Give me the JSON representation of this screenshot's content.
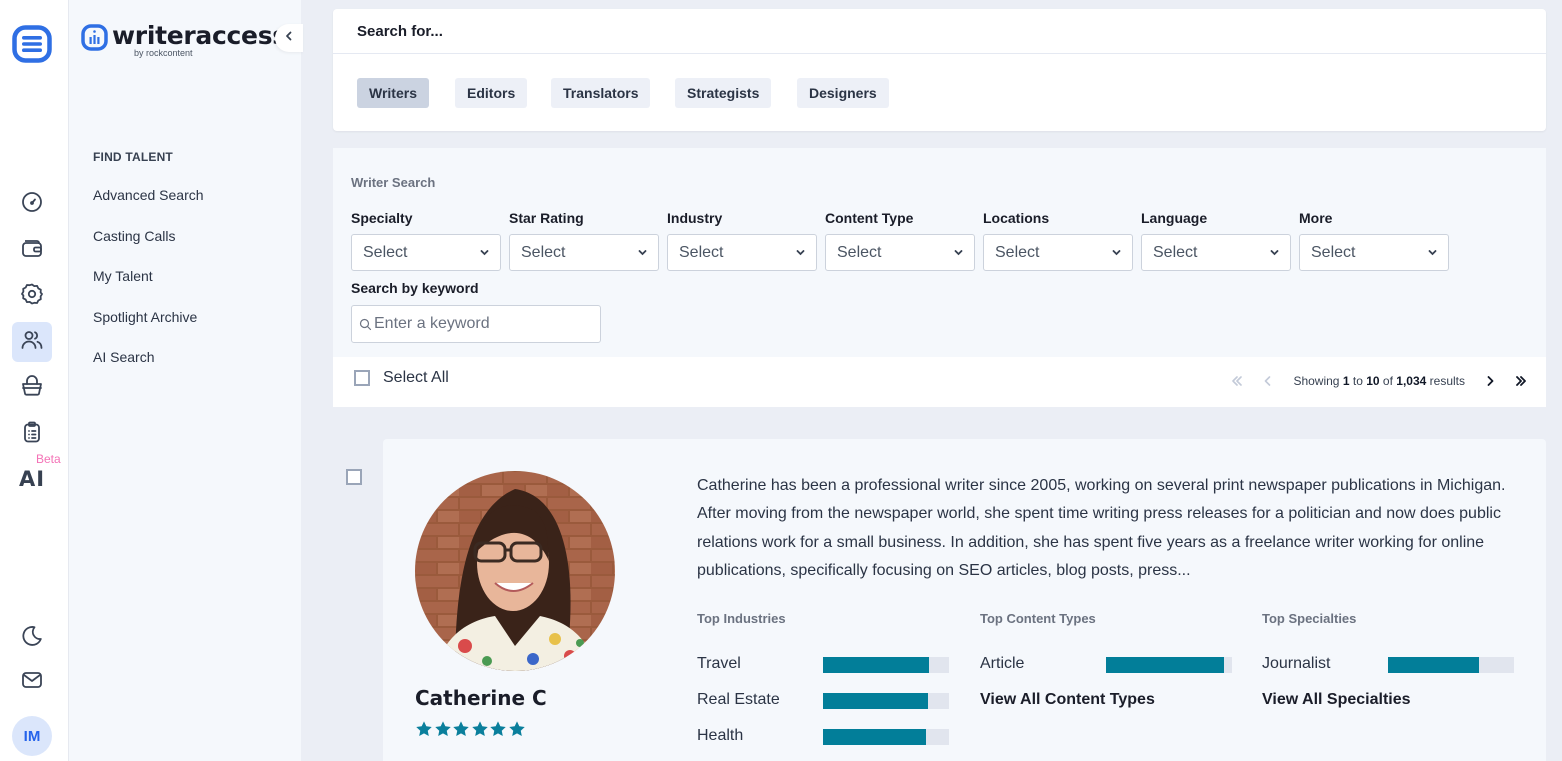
{
  "rail": {
    "items": [
      {
        "name": "dashboard",
        "icon": "gauge-icon"
      },
      {
        "name": "wallet",
        "icon": "wallet-icon"
      },
      {
        "name": "settings",
        "icon": "gear-icon"
      },
      {
        "name": "talent",
        "icon": "users-icon",
        "active": true
      },
      {
        "name": "shop",
        "icon": "basket-icon"
      },
      {
        "name": "orders",
        "icon": "clipboard-icon"
      },
      {
        "name": "ai",
        "label": "AI",
        "badge": "Beta"
      }
    ],
    "ai_label": "AI",
    "beta_badge": "Beta",
    "avatar_initials": "IM"
  },
  "brand": {
    "name": "writeraccess",
    "sub": "by rockcontent"
  },
  "subnav": {
    "section_title": "FIND TALENT",
    "items": [
      {
        "label": "Advanced Search"
      },
      {
        "label": "Casting Calls"
      },
      {
        "label": "My Talent"
      },
      {
        "label": "Spotlight Archive"
      },
      {
        "label": "AI Search"
      }
    ]
  },
  "search_for": {
    "title": "Search for...",
    "tabs": [
      {
        "label": "Writers",
        "active": true
      },
      {
        "label": "Editors"
      },
      {
        "label": "Translators"
      },
      {
        "label": "Strategists"
      },
      {
        "label": "Designers"
      }
    ]
  },
  "writer_search": {
    "title": "Writer Search",
    "filters": [
      {
        "label": "Specialty",
        "value": "Select"
      },
      {
        "label": "Star Rating",
        "value": "Select"
      },
      {
        "label": "Industry",
        "value": "Select"
      },
      {
        "label": "Content Type",
        "value": "Select"
      },
      {
        "label": "Locations",
        "value": "Select"
      },
      {
        "label": "Language",
        "value": "Select"
      },
      {
        "label": "More",
        "value": "Select"
      }
    ],
    "keyword_label": "Search by keyword",
    "keyword_placeholder": "Enter a keyword",
    "keyword_value": ""
  },
  "results": {
    "select_all_label": "Select All",
    "showing_prefix": "Showing",
    "from": "1",
    "to_word": "to",
    "to": "10",
    "of_word": "of",
    "total": "1,034",
    "suffix": "results"
  },
  "writers": [
    {
      "name": "Catherine C",
      "stars": 6,
      "bio": "Catherine has been a professional writer since 2005, working on several print newspaper publications in Michigan. After moving from the newspaper world, she spent time writing press releases for a politician and now does public relations work for a small business. In addition, she has spent five years as a freelance writer working for online publications, specifically focusing on SEO articles, blog posts, press...",
      "top_industries_title": "Top Industries",
      "top_industries": [
        {
          "label": "Travel",
          "percent": 84
        },
        {
          "label": "Real Estate",
          "percent": 83
        },
        {
          "label": "Health",
          "percent": 82
        }
      ],
      "top_content_types_title": "Top Content Types",
      "top_content_types": [
        {
          "label": "Article",
          "percent": 94
        }
      ],
      "view_all_content_types": "View All Content Types",
      "top_specialties_title": "Top Specialties",
      "top_specialties": [
        {
          "label": "Journalist",
          "percent": 72
        }
      ],
      "view_all_specialties": "View All Specialties"
    }
  ],
  "colors": {
    "accent_blue": "#2f6fe4",
    "bar_fill": "#027e99",
    "bar_track": "#e1e5ee",
    "star": "#0a7f9c",
    "beta": "#f472b6"
  }
}
